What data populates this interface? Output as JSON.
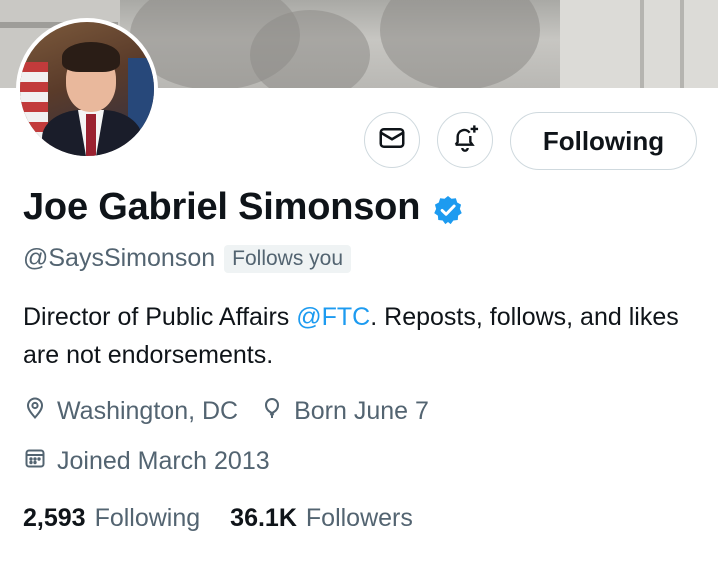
{
  "profile": {
    "name": "Joe Gabriel Simonson",
    "handle": "@SaysSimonson",
    "follows_you": "Follows you",
    "bio_pre": "Director of Public Affairs ",
    "bio_mention": "@FTC",
    "bio_post": ". Reposts, follows, and likes are not endorsements.",
    "location": "Washington, DC",
    "birthday": "Born June 7",
    "joined": "Joined March 2013"
  },
  "actions": {
    "follow_label": "Following"
  },
  "stats": {
    "following_count": "2,593",
    "following_label": "Following",
    "followers_count": "36.1K",
    "followers_label": "Followers"
  },
  "colors": {
    "accent": "#1d9bf0",
    "secondary_text": "#536471",
    "border": "#cfd9de"
  },
  "icons": {
    "message": "envelope-icon",
    "notify": "bell-plus-icon",
    "verified": "verified-badge-icon",
    "location": "location-pin-icon",
    "birthday": "balloon-icon",
    "joined": "calendar-icon"
  }
}
